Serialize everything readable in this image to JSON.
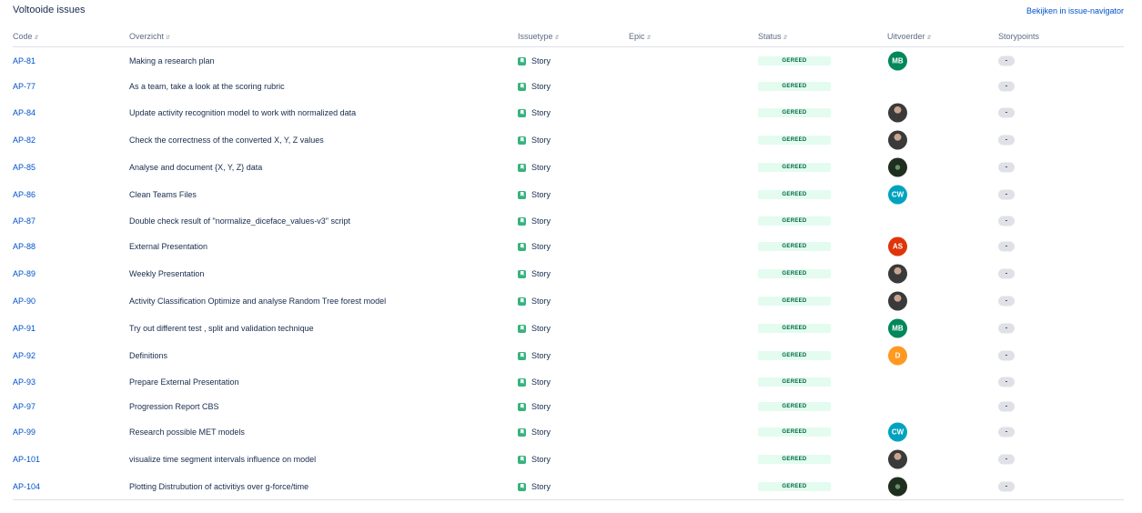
{
  "title": "Voltooide issues",
  "navigator_link": "Bekijken in issue-navigator",
  "columns": {
    "code": "Code",
    "summary": "Overzicht",
    "issuetype": "Issuetype",
    "epic": "Epic",
    "status": "Status",
    "assignee": "Uitvoerder",
    "storypoints": "Storypoints"
  },
  "rows": [
    {
      "code": "AP-81",
      "summary": "Making a research plan",
      "type": "Story",
      "status": "GEREED",
      "avatar": "initials",
      "initials": "MB",
      "avatar_color": "#00875a",
      "sp": "-"
    },
    {
      "code": "AP-77",
      "summary": "As a team, take a look at the scoring rubric",
      "type": "Story",
      "status": "GEREED",
      "avatar": "none",
      "initials": "",
      "avatar_color": "",
      "sp": "-"
    },
    {
      "code": "AP-84",
      "summary": "Update activity recognition model to work with normalized data",
      "type": "Story",
      "status": "GEREED",
      "avatar": "photo",
      "initials": "",
      "avatar_color": "",
      "sp": "-"
    },
    {
      "code": "AP-82",
      "summary": "Check the correctness of the converted X, Y, Z values",
      "type": "Story",
      "status": "GEREED",
      "avatar": "photo",
      "initials": "",
      "avatar_color": "",
      "sp": "-"
    },
    {
      "code": "AP-85",
      "summary": "Analyse and document {X, Y, Z} data",
      "type": "Story",
      "status": "GEREED",
      "avatar": "dark",
      "initials": "",
      "avatar_color": "",
      "sp": "-"
    },
    {
      "code": "AP-86",
      "summary": "Clean Teams Files",
      "type": "Story",
      "status": "GEREED",
      "avatar": "initials",
      "initials": "CW",
      "avatar_color": "#00a3bf",
      "sp": "-"
    },
    {
      "code": "AP-87",
      "summary": "Double check result of \"normalize_diceface_values-v3\" script",
      "type": "Story",
      "status": "GEREED",
      "avatar": "none",
      "initials": "",
      "avatar_color": "",
      "sp": "-"
    },
    {
      "code": "AP-88",
      "summary": "External Presentation",
      "type": "Story",
      "status": "GEREED",
      "avatar": "initials",
      "initials": "AS",
      "avatar_color": "#de350b",
      "sp": "-"
    },
    {
      "code": "AP-89",
      "summary": "Weekly Presentation",
      "type": "Story",
      "status": "GEREED",
      "avatar": "photo",
      "initials": "",
      "avatar_color": "",
      "sp": "-"
    },
    {
      "code": "AP-90",
      "summary": "Activity Classification Optimize and analyse Random Tree forest model",
      "type": "Story",
      "status": "GEREED",
      "avatar": "photo",
      "initials": "",
      "avatar_color": "",
      "sp": "-"
    },
    {
      "code": "AP-91",
      "summary": "Try out different test , split and validation technique",
      "type": "Story",
      "status": "GEREED",
      "avatar": "initials",
      "initials": "MB",
      "avatar_color": "#00875a",
      "sp": "-"
    },
    {
      "code": "AP-92",
      "summary": "Definitions",
      "type": "Story",
      "status": "GEREED",
      "avatar": "initials",
      "initials": "D",
      "avatar_color": "#ff991f",
      "sp": "-"
    },
    {
      "code": "AP-93",
      "summary": "Prepare External Presentation",
      "type": "Story",
      "status": "GEREED",
      "avatar": "none",
      "initials": "",
      "avatar_color": "",
      "sp": "-"
    },
    {
      "code": "AP-97",
      "summary": "Progression Report CBS",
      "type": "Story",
      "status": "GEREED",
      "avatar": "none",
      "initials": "",
      "avatar_color": "",
      "sp": "-"
    },
    {
      "code": "AP-99",
      "summary": "Research possible MET models",
      "type": "Story",
      "status": "GEREED",
      "avatar": "initials",
      "initials": "CW",
      "avatar_color": "#00a3bf",
      "sp": "-"
    },
    {
      "code": "AP-101",
      "summary": "visualize time segment intervals influence on model",
      "type": "Story",
      "status": "GEREED",
      "avatar": "photo",
      "initials": "",
      "avatar_color": "",
      "sp": "-"
    },
    {
      "code": "AP-104",
      "summary": "Plotting Distrubution of activitiys over g-force/time",
      "type": "Story",
      "status": "GEREED",
      "avatar": "dark",
      "initials": "",
      "avatar_color": "",
      "sp": "-"
    }
  ]
}
